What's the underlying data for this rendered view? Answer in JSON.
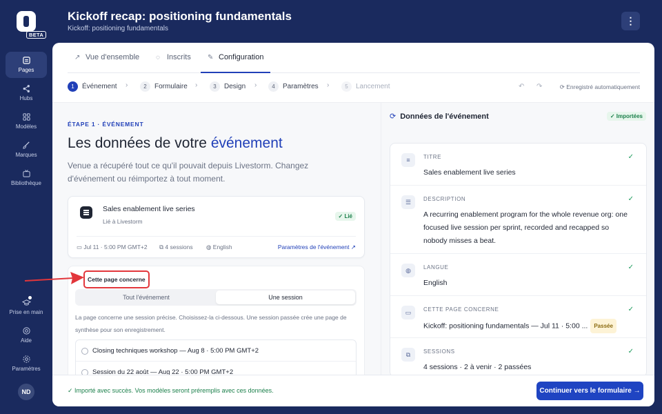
{
  "sidebar": {
    "beta": "BETA",
    "items": [
      {
        "label": "Pages",
        "icon": "pages-icon"
      },
      {
        "label": "Hubs",
        "icon": "share-icon"
      },
      {
        "label": "Modèles",
        "icon": "grid-icon"
      },
      {
        "label": "Marques",
        "icon": "brush-icon"
      },
      {
        "label": "Bibliothèque",
        "icon": "tv-icon"
      }
    ],
    "bottom": [
      {
        "label": "Prise en main",
        "icon": "graduation-cap-icon"
      },
      {
        "label": "Aide",
        "icon": "help-icon"
      },
      {
        "label": "Paramètres",
        "icon": "gear-icon"
      }
    ],
    "avatar": "ND"
  },
  "header": {
    "title": "Kickoff recap: positioning fundamentals",
    "subtitle": "Kickoff: positioning fundamentals",
    "menu": "⋮"
  },
  "tabs": [
    {
      "label": "Vue d'ensemble",
      "icon": "↗"
    },
    {
      "label": "Inscrits",
      "icon": "👤"
    },
    {
      "label": "Configuration",
      "icon": "✎"
    }
  ],
  "stepper": {
    "steps": [
      {
        "num": "1",
        "label": "Événement"
      },
      {
        "num": "2",
        "label": "Formulaire"
      },
      {
        "num": "3",
        "label": "Design"
      },
      {
        "num": "4",
        "label": "Paramètres"
      },
      {
        "num": "5",
        "label": "Lancement"
      }
    ],
    "undo": "↶",
    "redo": "↷",
    "autosave": "⟳  Enregistré automatiquement"
  },
  "left": {
    "eyebrow": "ÉTAPE 1 · ÉVÉNEMENT",
    "title_main": "Les données de votre ",
    "title_highlight": "événement",
    "lead": "Venue a récupéré tout ce qu'il pouvait depuis Livestorm. Changez d'événement ou réimportez à tout moment.",
    "event": {
      "title": "Sales enablement live series",
      "subtitle": "Lié à Livestorm",
      "badge": "✓ Lié",
      "date": "▭  Jul 11 · 5:00 PM GMT+2",
      "sessions": "⧉  4 sessions",
      "language": "◍  English",
      "link": "Paramètres de l'événement ↗"
    },
    "scope": {
      "label": "Cette page concerne",
      "options": [
        "Tout l'événement",
        "Une session"
      ],
      "help": "La page concerne une session précise. Choisissez-la ci-dessous. Une session passée crée une page de synthèse pour son enregistrement.",
      "sessions": [
        "Closing techniques workshop — Aug 8 · 5:00 PM GMT+2",
        "Session du 22 août — Aug 22 · 5:00 PM GMT+2"
      ]
    }
  },
  "right": {
    "title": "Données de l'événement",
    "badge": "✓ Importées",
    "fields": [
      {
        "label": "TITRE",
        "value": "Sales enablement live series",
        "icon": "≡"
      },
      {
        "label": "DESCRIPTION",
        "value": "A recurring enablement program for the whole revenue org: one focused live session per sprint, recorded and recapped so nobody misses a beat.",
        "icon": "☰"
      },
      {
        "label": "LANGUE",
        "value": "English",
        "icon": "◍"
      },
      {
        "label": "CETTE PAGE CONCERNE",
        "value": "Kickoff: positioning fundamentals — Jul 11 · 5:00 ...",
        "badge": "Passée",
        "icon": "▭"
      },
      {
        "label": "SESSIONS",
        "value": "4 sessions · 2 à venir · 2 passées",
        "icon": "⧉"
      }
    ]
  },
  "footer": {
    "message": "✓  Importé avec succès. Vos modèles seront préremplis avec ces données.",
    "cta": "Continuer vers le formulaire  →"
  }
}
